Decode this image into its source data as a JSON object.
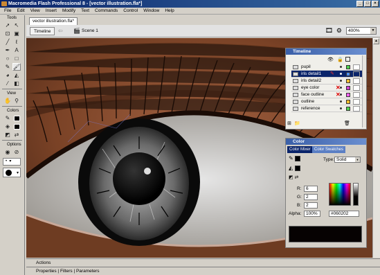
{
  "window": {
    "title": "Macromedia Flash Professional 8 - [vector illustration.fla*]"
  },
  "menu": [
    "File",
    "Edit",
    "View",
    "Insert",
    "Modify",
    "Text",
    "Commands",
    "Control",
    "Window",
    "Help"
  ],
  "tools": {
    "header": "Tools",
    "view_header": "View",
    "colors_header": "Colors",
    "options_header": "Options",
    "icons": [
      "arrow-icon",
      "subselect-icon",
      "free-transform-icon",
      "gradient-transform-icon",
      "line-icon",
      "lasso-icon",
      "pen-icon",
      "text-icon",
      "oval-icon",
      "rectangle-icon",
      "pencil-icon",
      "brush-icon",
      "ink-bottle-icon",
      "paint-bucket-icon",
      "eyedropper-icon",
      "eraser-icon"
    ],
    "view_icons": [
      "hand-icon",
      "zoom-icon"
    ]
  },
  "document": {
    "tab_label": "vector illustration.fla*",
    "timeline_button": "Timeline",
    "scene_label": "Scene 1",
    "zoom": "400%"
  },
  "timeline": {
    "title": "Timeline",
    "layers": [
      {
        "name": "pupil",
        "selected": false,
        "hidden": false,
        "color": "#4fd14f"
      },
      {
        "name": "iris detail1",
        "selected": true,
        "hidden": false,
        "color": "#4f90ff"
      },
      {
        "name": "iris detail2",
        "selected": false,
        "hidden": false,
        "color": "#ffbf2f"
      },
      {
        "name": "eye color",
        "selected": false,
        "hidden": true,
        "color": "#d040d0"
      },
      {
        "name": "face outline",
        "selected": false,
        "hidden": true,
        "color": "#ff60ff"
      },
      {
        "name": "outline",
        "selected": false,
        "hidden": false,
        "color": "#ffbf2f"
      },
      {
        "name": "reference",
        "selected": false,
        "hidden": false,
        "color": "#4fd14f"
      }
    ]
  },
  "color": {
    "title": "Color",
    "tab_mixer": "Color Mixer",
    "tab_swatches": "Color Swatches",
    "type_label": "Type:",
    "type_value": "Solid",
    "r_label": "R:",
    "r_value": "6",
    "g_label": "G:",
    "g_value": "2",
    "b_label": "B:",
    "b_value": "2",
    "alpha_label": "Alpha:",
    "alpha_value": "100%",
    "hex_value": "#060202"
  },
  "bottom": {
    "actions": "Actions",
    "properties": "Properties",
    "filters": "Filters",
    "parameters": "Parameters"
  }
}
